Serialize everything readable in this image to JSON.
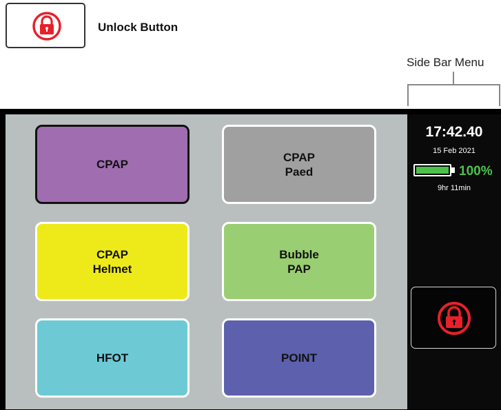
{
  "legend": {
    "label": "Unlock Button",
    "icon": "padlock-icon"
  },
  "annotation": {
    "sidebar_label": "Side Bar Menu"
  },
  "modes": [
    {
      "line1": "CPAP",
      "line2": "",
      "color": "#a06eb0",
      "selected": true
    },
    {
      "line1": "CPAP",
      "line2": "Paed",
      "color": "#a0a0a0",
      "selected": false
    },
    {
      "line1": "CPAP",
      "line2": "Helmet",
      "color": "#eeea1a",
      "selected": false
    },
    {
      "line1": "Bubble",
      "line2": "PAP",
      "color": "#99ce72",
      "selected": false
    },
    {
      "line1": "HFOT",
      "line2": "",
      "color": "#6dcad5",
      "selected": false
    },
    {
      "line1": "POINT",
      "line2": "",
      "color": "#5d60ad",
      "selected": false
    }
  ],
  "sidebar": {
    "time": "17:42.40",
    "date": "15 Feb 2021",
    "battery_percent": "100%",
    "battery_level": 1.0,
    "battery_color": "#4cc24a",
    "battery_remaining": "9hr 11min",
    "lock_icon": "padlock-icon",
    "lock_color": "#e8202a"
  }
}
